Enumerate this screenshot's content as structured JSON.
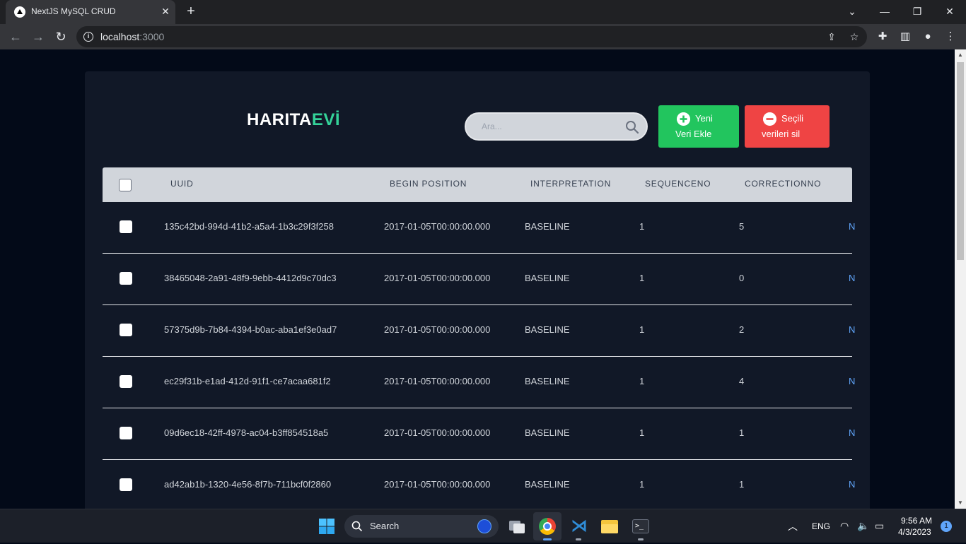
{
  "browser": {
    "tab_title": "NextJS MySQL CRUD",
    "url_host": "localhost",
    "url_port": ":3000"
  },
  "app": {
    "logo_part1": "HARITA",
    "logo_part2": "EVİ",
    "search_placeholder": "Ara...",
    "add_button": {
      "line1": "Yeni",
      "line2": "Veri Ekle"
    },
    "delete_button": {
      "line1": "Seçili",
      "line2": "verileri sil"
    },
    "colors": {
      "add": "#22c55e",
      "delete": "#ef4444",
      "accent": "#34d399",
      "card": "#111827"
    }
  },
  "table": {
    "columns": [
      "UUID",
      "BEGIN POSITION",
      "INTERPRETATION",
      "SEQUENCENO",
      "CORRECTIONNO"
    ],
    "rows": [
      {
        "uuid": "135c42bd-994d-41b2-a5a4-1b3c29f3f258",
        "begin": "2017-01-05T00:00:00.000",
        "interp": "BASELINE",
        "seq": "1",
        "corr": "5",
        "cut": "N"
      },
      {
        "uuid": "38465048-2a91-48f9-9ebb-4412d9c70dc3",
        "begin": "2017-01-05T00:00:00.000",
        "interp": "BASELINE",
        "seq": "1",
        "corr": "0",
        "cut": "N"
      },
      {
        "uuid": "57375d9b-7b84-4394-b0ac-aba1ef3e0ad7",
        "begin": "2017-01-05T00:00:00.000",
        "interp": "BASELINE",
        "seq": "1",
        "corr": "2",
        "cut": "N"
      },
      {
        "uuid": "ec29f31b-e1ad-412d-91f1-ce7acaa681f2",
        "begin": "2017-01-05T00:00:00.000",
        "interp": "BASELINE",
        "seq": "1",
        "corr": "4",
        "cut": "N"
      },
      {
        "uuid": "09d6ec18-42ff-4978-ac04-b3ff854518a5",
        "begin": "2017-01-05T00:00:00.000",
        "interp": "BASELINE",
        "seq": "1",
        "corr": "1",
        "cut": "N"
      },
      {
        "uuid": "ad42ab1b-1320-4e56-8f7b-711bcf0f2860",
        "begin": "2017-01-05T00:00:00.000",
        "interp": "BASELINE",
        "seq": "1",
        "corr": "1",
        "cut": "N"
      }
    ]
  },
  "taskbar": {
    "search_label": "Search",
    "language": "ENG",
    "time": "9:56 AM",
    "date": "4/3/2023",
    "notification_count": "1"
  }
}
